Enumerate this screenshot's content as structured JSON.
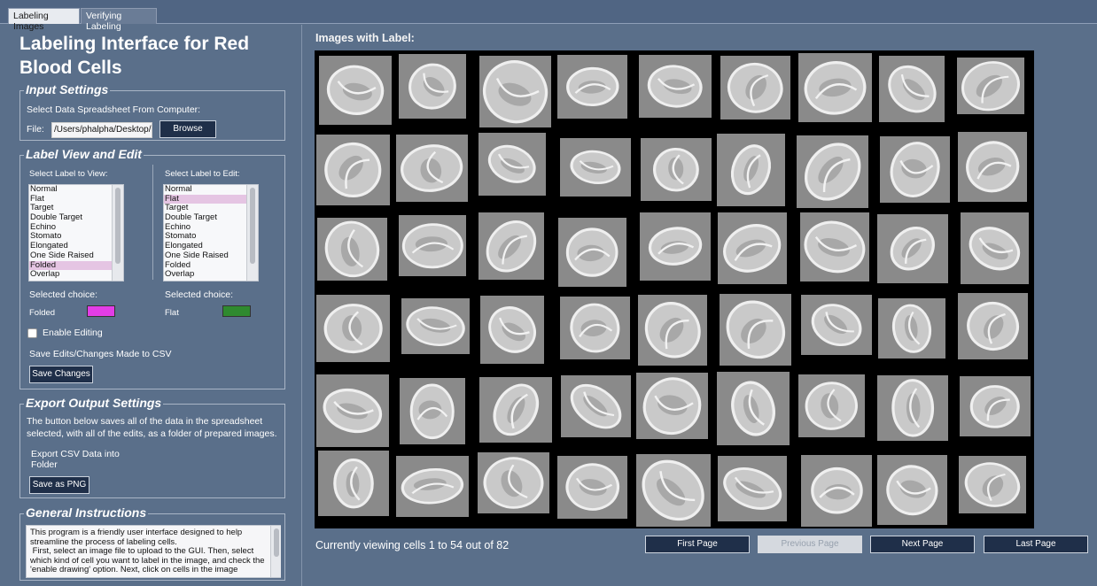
{
  "tabs": [
    {
      "label": "Labeling Images",
      "active": true
    },
    {
      "label": "Verifying Labeling",
      "active": false
    }
  ],
  "title": "Labeling Interface for Red Blood Cells",
  "input_settings": {
    "legend": "Input Settings",
    "instruction": "Select Data Spreadsheet From Computer:",
    "file_label": "File:",
    "file_value": "/Users/phalpha/Desktop/S",
    "browse_label": "Browse"
  },
  "label_view": {
    "legend": "Label View and Edit",
    "view_title": "Select Label to View:",
    "edit_title": "Select Label to Edit:",
    "labels": [
      "Normal",
      "Flat",
      "Target",
      "Double Target",
      "Echino",
      "Stomato",
      "Elongated",
      "One Side Raised",
      "Folded",
      "Overlap"
    ],
    "view_selected": "Folded",
    "edit_selected": "Flat",
    "selected_choice_label": "Selected choice:",
    "view_choice": "Folded",
    "view_color": "#e23de6",
    "edit_choice": "Flat",
    "edit_color": "#2f8a2f",
    "enable_editing_label": "Enable Editing",
    "enable_editing_checked": false,
    "save_text": "Save Edits/Changes Made to CSV",
    "save_button": "Save Changes"
  },
  "export": {
    "legend": "Export Output Settings",
    "description": "The button below saves all of the data in the spreadsheet selected, with all of the edits, as a folder of prepared images.",
    "export_text_1": "Export CSV Data into",
    "export_text_2": "Folder",
    "save_png_button": "Save as PNG"
  },
  "instructions": {
    "legend": "General Instructions",
    "text": "This program is a friendly user interface designed to help streamline the process of labeling cells.\n First, select an image file to upload to the GUI. Then, select which kind of cell you want to label in the image, and check the 'enable drawing' option. Next, click on cells in the image"
  },
  "images_panel": {
    "label": "Images with Label:",
    "viewing_text": "Currently viewing cells 1 to 54 out of 82",
    "first_page": "First Page",
    "previous_page": "Previous Page",
    "next_page": "Next Page",
    "last_page": "Last Page",
    "previous_enabled": false
  },
  "grid": {
    "rows": 6,
    "cols": 9,
    "shown_cells": 54,
    "icon": "red-blood-cell-micrograph"
  }
}
